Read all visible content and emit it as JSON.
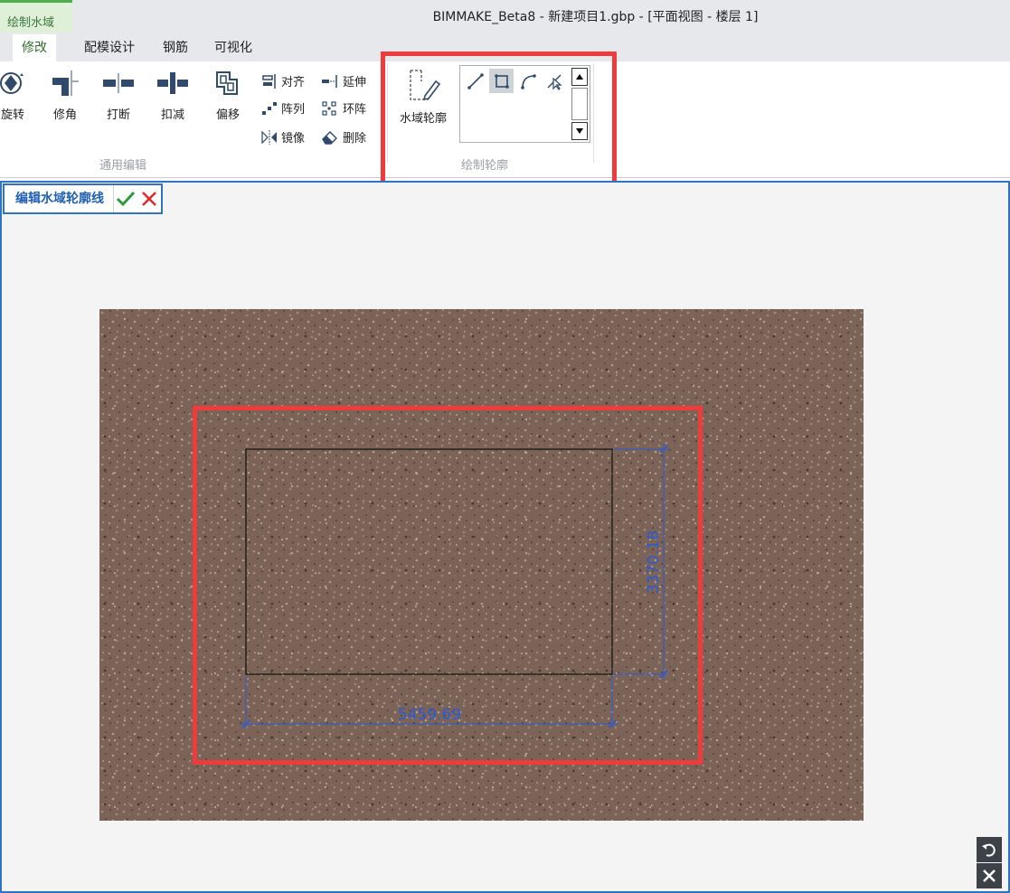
{
  "window": {
    "title": "BIMMAKE_Beta8 - 新建项目1.gbp - [平面视图 - 楼层 1]"
  },
  "context_tab": "绘制水域",
  "tabs": [
    {
      "label": "修改",
      "active": true
    },
    {
      "label": "配模设计",
      "active": false
    },
    {
      "label": "钢筋",
      "active": false
    },
    {
      "label": "可视化",
      "active": false
    }
  ],
  "ribbon": {
    "general_edit": {
      "label": "通用编辑",
      "tools": [
        {
          "label": "旋转",
          "icon": "rotate-icon"
        },
        {
          "label": "修角",
          "icon": "trim-corner-icon"
        },
        {
          "label": "打断",
          "icon": "break-icon"
        },
        {
          "label": "扣减",
          "icon": "deduct-icon"
        },
        {
          "label": "偏移",
          "icon": "offset-icon"
        }
      ],
      "small_tools": [
        {
          "label": "对齐",
          "icon": "align-icon"
        },
        {
          "label": "延伸",
          "icon": "extend-icon"
        },
        {
          "label": "阵列",
          "icon": "array-icon"
        },
        {
          "label": "环阵",
          "icon": "circular-array-icon"
        },
        {
          "label": "镜像",
          "icon": "mirror-icon"
        },
        {
          "label": "删除",
          "icon": "erase-icon"
        }
      ]
    },
    "draw_outline": {
      "label": "绘制轮廓",
      "tool": {
        "label": "水域轮廓",
        "icon": "water-outline-icon"
      },
      "gallery": [
        {
          "icon": "line-icon",
          "selected": false
        },
        {
          "icon": "rectangle-icon",
          "selected": true
        },
        {
          "icon": "arc-icon",
          "selected": false
        },
        {
          "icon": "pick-line-icon",
          "selected": false
        }
      ]
    }
  },
  "edit_mode": {
    "title": "编辑水域轮廓线",
    "confirm_icon": "check-icon",
    "cancel_icon": "close-icon"
  },
  "canvas": {
    "dimension_width": "5459.69",
    "dimension_height": "3370.18",
    "colors": {
      "dimension": "#2a5ad6",
      "highlight": "#ef3b3b",
      "accent": "#2f73c5",
      "gravel": "#7b6357"
    }
  },
  "view_controls": [
    {
      "icon": "rotate-view-icon"
    },
    {
      "icon": "close-view-icon"
    }
  ]
}
